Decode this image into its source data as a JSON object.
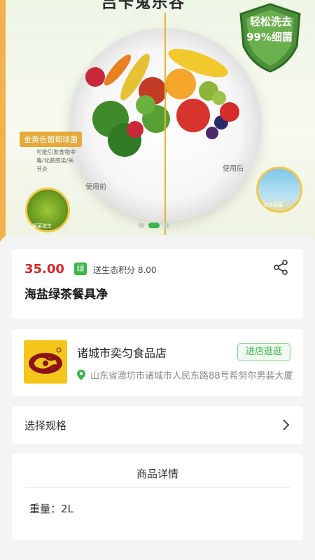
{
  "banner": {
    "title": "吕卡鬼乐谷",
    "shield_line1": "轻松洗去",
    "shield_line2": "99%细菌",
    "callout_tag": "金黄色葡萄球菌",
    "callout_desc": "可能引发食物中毒/化脓感染/关节炎",
    "before_label": "使用前",
    "after_label": "使用后",
    "before_circle_label": "细菌滋生",
    "after_circle_label": "洗去细菌",
    "slides": 3,
    "active_slide": 2
  },
  "product": {
    "price": "35.00",
    "green_badge": "绿",
    "eco_points": "送生态积分 8.00",
    "name": "海盐绿茶餐具净"
  },
  "shop": {
    "name": "诸城市奕匀食品店",
    "visit_label": "进店逛逛",
    "address": "山东省潍坊市诸城市人民东路88号希努尔男装大厦"
  },
  "spec": {
    "label": "选择规格"
  },
  "detail": {
    "title": "商品详情",
    "weight_label": "重量：",
    "weight_value": "2L"
  },
  "colors": {
    "price_red": "#d7262a",
    "brand_green": "#3bb54a",
    "shop_logo_yellow": "#f4c51b",
    "shop_logo_maroon": "#8a1414"
  },
  "icons": {
    "share": "share-icon",
    "location": "location-icon",
    "chevron": "chevron-right-icon"
  }
}
